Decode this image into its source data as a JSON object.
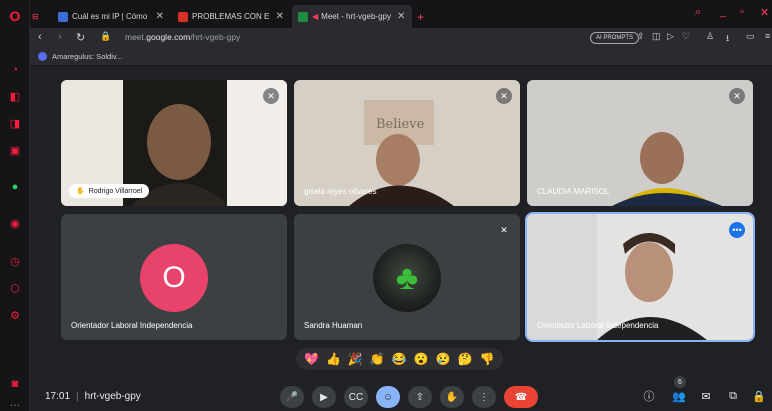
{
  "browser": {
    "tabs": [
      {
        "title": "Cuál es mi IP | Cómo saber",
        "favicon_color": "#3a6fd8"
      },
      {
        "title": "PROBLEMAS CON EL LINK",
        "favicon_color": "#d93025"
      },
      {
        "title": "Meet - hrt-vgeb-gpy",
        "favicon_color": "#1e8e3e"
      }
    ],
    "url": {
      "prefix": "meet.",
      "domain": "google.com",
      "path": "/hrt-vgeb-gpy"
    },
    "ai_pill": "AI PROMPTS",
    "bookmark": "Amaregulus: Soldiv..."
  },
  "meeting": {
    "code": "hrt-vgeb-gpy",
    "time": "17:01",
    "participants": [
      {
        "name": "Rodrigo Villarroel",
        "muted": true,
        "highlighted": true
      },
      {
        "name": "gisela reyes olivares",
        "muted": true
      },
      {
        "name": "CLAUDIA MARISOL",
        "muted": true
      },
      {
        "name": "Orientador Laboral Independencia",
        "avatar_letter": "O",
        "avatar_color": "#e8436b"
      },
      {
        "name": "Sandra Huaman",
        "muted": true
      },
      {
        "name": "Orientador Laboral Independencia",
        "self": true
      }
    ],
    "reactions": [
      "💖",
      "👍",
      "🎉",
      "👏",
      "😂",
      "😮",
      "😢",
      "🤔",
      "👎"
    ],
    "participant_count": "6"
  },
  "colors": {
    "accent": "#8ab4f8",
    "end_call": "#ea4335",
    "opera_red": "#ff1b3d"
  }
}
